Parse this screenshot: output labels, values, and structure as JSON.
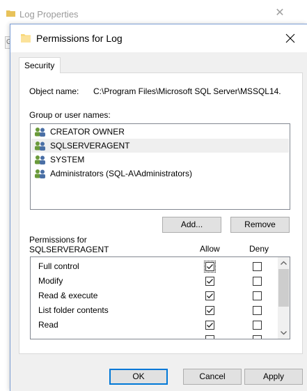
{
  "background_window": {
    "title": "Log Properties",
    "stub_text": "G"
  },
  "dialog": {
    "title": "Permissions for Log",
    "tab_label": "Security",
    "object_name_label": "Object name:",
    "object_name_value": "C:\\Program Files\\Microsoft SQL Server\\MSSQL14.",
    "group_label": "Group or user names:",
    "users": [
      {
        "name": "CREATOR OWNER",
        "selected": false
      },
      {
        "name": "SQLSERVERAGENT",
        "selected": true
      },
      {
        "name": "SYSTEM",
        "selected": false
      },
      {
        "name": "Administrators (SQL-A\\Administrators)",
        "selected": false
      }
    ],
    "add_label": "Add...",
    "remove_label": "Remove",
    "permissions_for_label": "Permissions for",
    "permissions_for_user": "SQLSERVERAGENT",
    "allow_header": "Allow",
    "deny_header": "Deny",
    "permissions": [
      {
        "name": "Full control",
        "allow": true,
        "deny": false
      },
      {
        "name": "Modify",
        "allow": true,
        "deny": false
      },
      {
        "name": "Read & execute",
        "allow": true,
        "deny": false
      },
      {
        "name": "List folder contents",
        "allow": true,
        "deny": false
      },
      {
        "name": "Read",
        "allow": true,
        "deny": false
      },
      {
        "name": "",
        "allow": false,
        "deny": false
      }
    ],
    "ok_label": "OK",
    "cancel_label": "Cancel",
    "apply_label": "Apply"
  },
  "colors": {
    "folder_yellow": "#f8d775",
    "user_icon_green": "#6a9a3a",
    "user_icon_blue": "#4a6fa5",
    "focus_blue": "#0078d7"
  }
}
